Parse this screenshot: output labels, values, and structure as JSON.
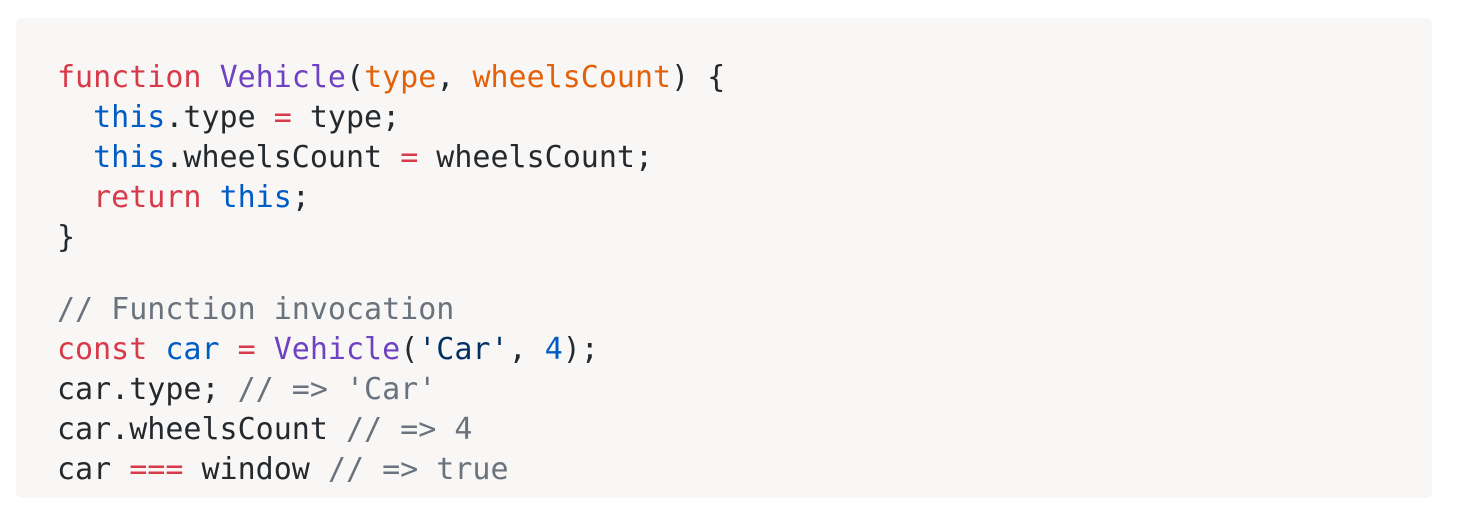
{
  "code": {
    "lines": [
      [
        {
          "t": "function",
          "c": "kw"
        },
        {
          "t": " ",
          "c": "pl"
        },
        {
          "t": "Vehicle",
          "c": "fn"
        },
        {
          "t": "(",
          "c": "pl"
        },
        {
          "t": "type",
          "c": "param"
        },
        {
          "t": ", ",
          "c": "pl"
        },
        {
          "t": "wheelsCount",
          "c": "param"
        },
        {
          "t": ") {",
          "c": "pl"
        }
      ],
      [
        {
          "t": "  ",
          "c": "pl"
        },
        {
          "t": "this",
          "c": "this"
        },
        {
          "t": ".type ",
          "c": "pl"
        },
        {
          "t": "=",
          "c": "op"
        },
        {
          "t": " type;",
          "c": "pl"
        }
      ],
      [
        {
          "t": "  ",
          "c": "pl"
        },
        {
          "t": "this",
          "c": "this"
        },
        {
          "t": ".wheelsCount ",
          "c": "pl"
        },
        {
          "t": "=",
          "c": "op"
        },
        {
          "t": " wheelsCount;",
          "c": "pl"
        }
      ],
      [
        {
          "t": "  ",
          "c": "pl"
        },
        {
          "t": "return",
          "c": "kw"
        },
        {
          "t": " ",
          "c": "pl"
        },
        {
          "t": "this",
          "c": "this"
        },
        {
          "t": ";",
          "c": "pl"
        }
      ],
      [
        {
          "t": "}",
          "c": "pl"
        }
      ],
      [],
      [
        {
          "t": "// Function invocation",
          "c": "cm"
        }
      ],
      [
        {
          "t": "const",
          "c": "kw"
        },
        {
          "t": " ",
          "c": "pl"
        },
        {
          "t": "car",
          "c": "this"
        },
        {
          "t": " ",
          "c": "pl"
        },
        {
          "t": "=",
          "c": "op"
        },
        {
          "t": " ",
          "c": "pl"
        },
        {
          "t": "Vehicle",
          "c": "fn"
        },
        {
          "t": "(",
          "c": "pl"
        },
        {
          "t": "'Car'",
          "c": "str"
        },
        {
          "t": ", ",
          "c": "pl"
        },
        {
          "t": "4",
          "c": "num"
        },
        {
          "t": ");",
          "c": "pl"
        }
      ],
      [
        {
          "t": "car.type; ",
          "c": "pl"
        },
        {
          "t": "// => 'Car'",
          "c": "cm"
        }
      ],
      [
        {
          "t": "car.wheelsCount ",
          "c": "pl"
        },
        {
          "t": "// => 4",
          "c": "cm"
        }
      ],
      [
        {
          "t": "car ",
          "c": "pl"
        },
        {
          "t": "===",
          "c": "op"
        },
        {
          "t": " window ",
          "c": "pl"
        },
        {
          "t": "// => true",
          "c": "cm"
        }
      ]
    ],
    "colors": {
      "background": "#f8f7f6",
      "keyword": "#d73a49",
      "function": "#6f42c1",
      "parameter": "#e36209",
      "this": "#005cc5",
      "string": "#032f62",
      "comment": "#6a737d",
      "plain": "#24292e"
    }
  }
}
